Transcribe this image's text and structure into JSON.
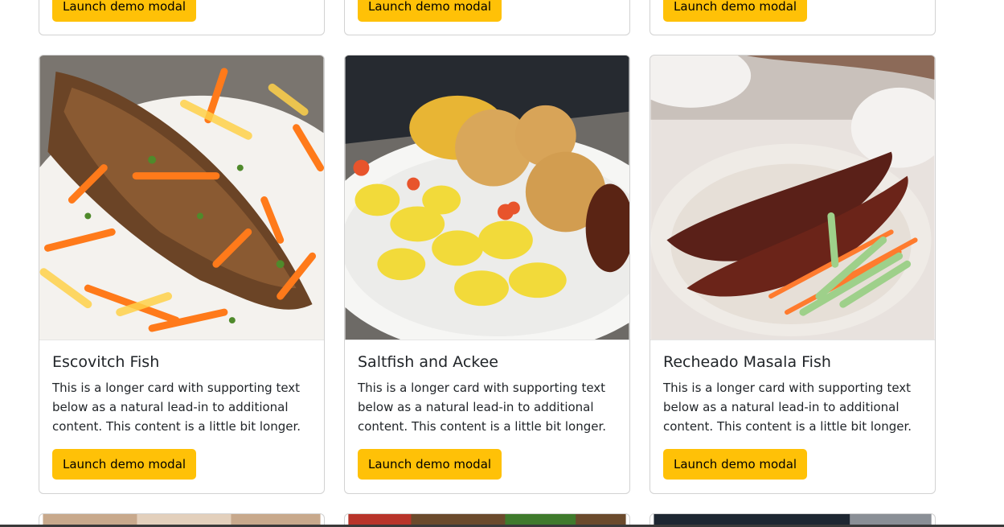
{
  "cards_top": [
    {
      "button_label": "Launch demo modal"
    },
    {
      "button_label": "Launch demo modal"
    },
    {
      "button_label": "Launch demo modal"
    }
  ],
  "cards": [
    {
      "title": "Escovitch Fish",
      "text": "This is a longer card with supporting text below as a natural lead-in to additional content. This content is a little bit longer.",
      "button_label": "Launch demo modal"
    },
    {
      "title": "Saltfish and Ackee",
      "text": "This is a longer card with supporting text below as a natural lead-in to additional content. This content is a little bit longer.",
      "button_label": "Launch demo modal"
    },
    {
      "title": "Recheado Masala Fish",
      "text": "This is a longer card with supporting text below as a natural lead-in to additional content. This content is a little bit longer.",
      "button_label": "Launch demo modal"
    }
  ],
  "colors": {
    "button_bg": "#ffc107",
    "border": "#dcdcdc"
  }
}
